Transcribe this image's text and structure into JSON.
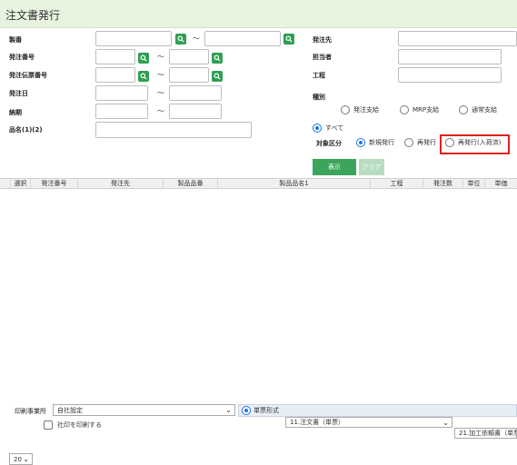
{
  "header": {
    "title": "注文書発行"
  },
  "form": {
    "seiban_label": "製番",
    "order_no_label": "発注番号",
    "order_slip_label": "発注伝票番号",
    "order_date_label": "発注日",
    "due_label": "納期",
    "item_name_label": "品名(1)(2)",
    "supplier_label": "発注先",
    "person_label": "担当者",
    "process_label": "工程",
    "type_label": "種別",
    "range_sep": "〜"
  },
  "type_options": [
    "発注支給",
    "MRP支給",
    "通常支給"
  ],
  "all_option": "すべて",
  "target": {
    "label": "対象区分",
    "options": [
      "新規発行",
      "再発行",
      "再発行(入荷済)"
    ],
    "selected": 0
  },
  "buttons": {
    "show": "表示",
    "clear": "クリア"
  },
  "table": {
    "columns": [
      "選択",
      "発注番号",
      "発注先",
      "製品品番",
      "製品品名1",
      "工程",
      "発注数",
      "単位",
      "単価"
    ]
  },
  "footer": {
    "print_office_label": "印刷事業所",
    "print_office_value": "自社設定",
    "form_type_label": "単票形式",
    "form_value_1": "11.注文書（単票）",
    "form_value_2": "21.加工依頼書（単票",
    "page_size": "20",
    "stamp_label": "社印を印刷する"
  },
  "colors": {
    "accent": "#2e9f53",
    "highlight": "#e0201b",
    "header_bg": "#e8f3df"
  }
}
